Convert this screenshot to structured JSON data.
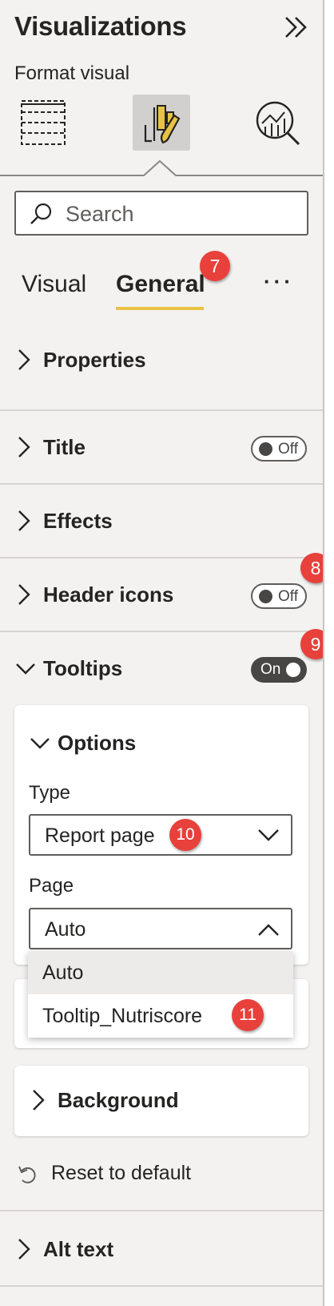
{
  "header": {
    "title": "Visualizations",
    "subtitle": "Format visual",
    "icons": [
      "build-visual-icon",
      "format-visual-icon",
      "analytics-icon",
      "collapse-pane-icon"
    ]
  },
  "search": {
    "placeholder": "Search"
  },
  "tabs": [
    {
      "label": "Visual",
      "selected": false
    },
    {
      "label": "General",
      "selected": true
    }
  ],
  "more_label": "···",
  "sections": {
    "properties": {
      "label": "Properties"
    },
    "title": {
      "label": "Title",
      "toggle": "Off"
    },
    "effects": {
      "label": "Effects"
    },
    "header_icons": {
      "label": "Header icons",
      "toggle": "Off"
    },
    "tooltips": {
      "label": "Tooltips",
      "toggle": "On"
    },
    "alt_text": {
      "label": "Alt text"
    }
  },
  "tooltips_card": {
    "options_label": "Options",
    "type_label": "Type",
    "type_value": "Report page",
    "page_label": "Page",
    "page_value": "Auto",
    "page_options": [
      "Auto",
      "Tooltip_Nutriscore"
    ]
  },
  "background_label": "Background",
  "reset_label": "Reset to default",
  "badges": {
    "b7": "7",
    "b8": "8",
    "b9": "9",
    "b10": "10",
    "b11": "11"
  },
  "colors": {
    "accent": "#e8c343",
    "badge": "#e8403a",
    "toggle_on": "#484644"
  }
}
